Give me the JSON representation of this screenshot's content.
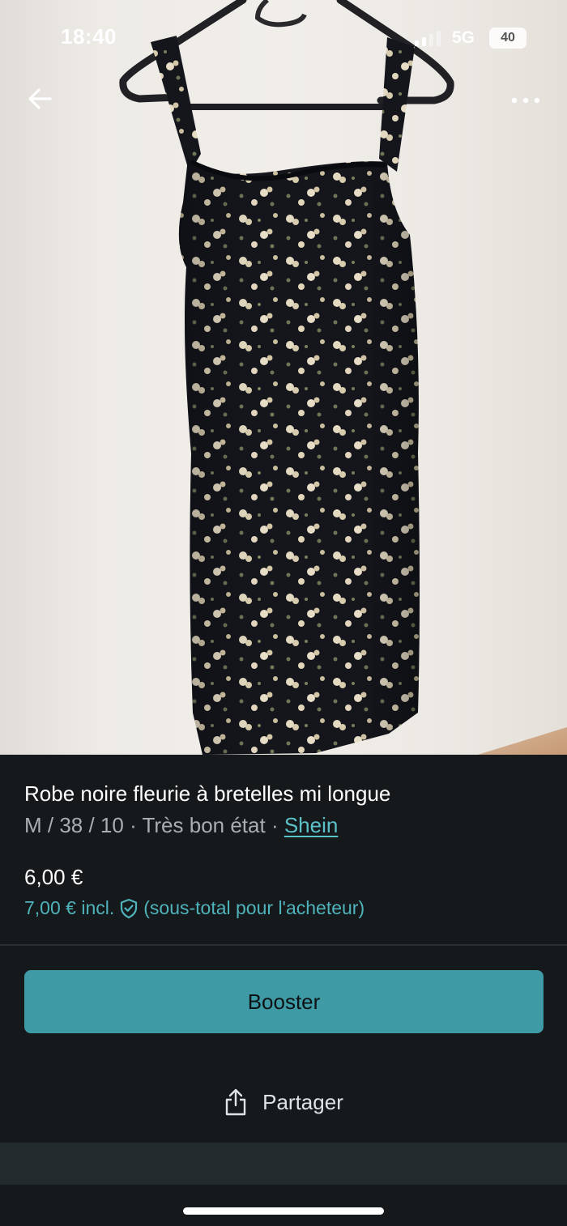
{
  "status_bar": {
    "time": "18:40",
    "network": "5G",
    "battery": "40"
  },
  "photo": {
    "description_icon": "dress-photo"
  },
  "nav": {
    "back_icon": "arrow-left-icon",
    "more_icon": "more-dots-icon"
  },
  "listing": {
    "title": "Robe noire fleurie à bretelles mi longue",
    "size": "M / 38 / 10",
    "separator": " · ",
    "condition": "Très bon état",
    "brand": "Shein",
    "price": "6,00 €",
    "price_incl": "7,00 € incl.",
    "price_incl_note": "(sous-total pour l'acheteur)"
  },
  "actions": {
    "booster_label": "Booster",
    "share_label": "Partager"
  },
  "colors": {
    "accent": "#3e9ba6",
    "link": "#5cc2c9",
    "background": "#16191b"
  }
}
